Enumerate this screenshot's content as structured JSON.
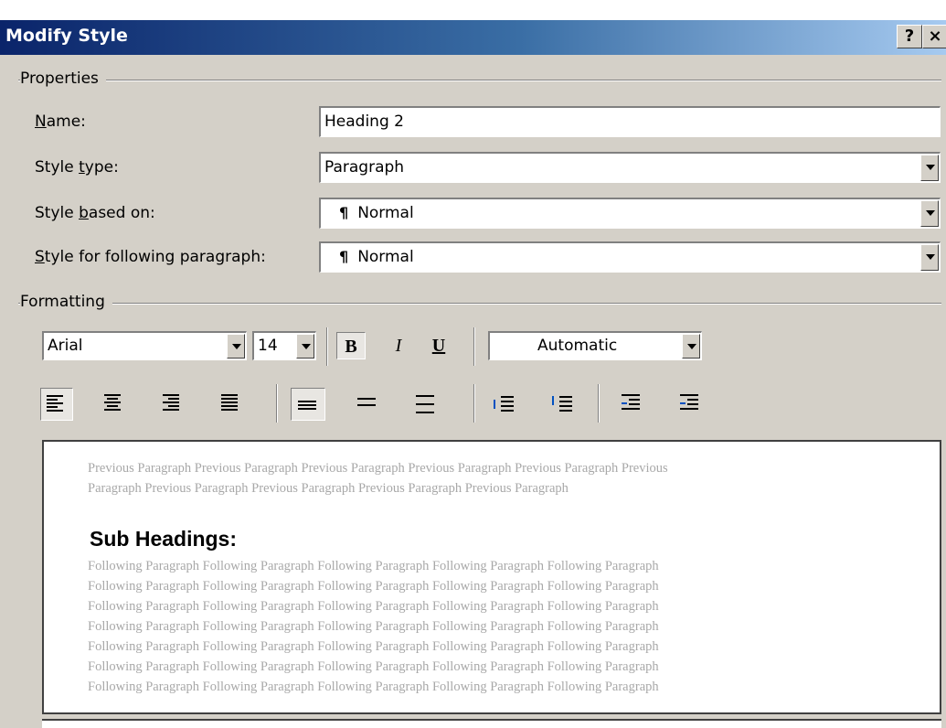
{
  "window": {
    "title": "Modify Style",
    "help_label": "?",
    "close_label": "×"
  },
  "properties": {
    "group_label": "Properties",
    "name": {
      "label_u": "N",
      "label_rest": "ame:",
      "value": "Heading 2"
    },
    "style_type": {
      "label_pre": "Style ",
      "label_u": "t",
      "label_rest": "ype:",
      "value": "Paragraph"
    },
    "based_on": {
      "label_pre": "Style ",
      "label_u": "b",
      "label_rest": "ased on:",
      "value": "Normal",
      "pilcrow": "¶"
    },
    "following": {
      "label_u": "S",
      "label_rest": "tyle for following paragraph:",
      "value": "Normal",
      "pilcrow": "¶"
    }
  },
  "formatting": {
    "group_label": "Formatting",
    "font": "Arial",
    "size": "14",
    "bold": "B",
    "italic": "I",
    "underline": "U",
    "color": "Automatic"
  },
  "preview": {
    "previous_lines": [
      "Previous Paragraph Previous Paragraph Previous Paragraph Previous Paragraph Previous Paragraph Previous",
      "Paragraph Previous Paragraph Previous Paragraph Previous Paragraph Previous Paragraph"
    ],
    "heading": "Sub Headings:",
    "following_lines": [
      "Following Paragraph Following Paragraph Following Paragraph Following Paragraph Following Paragraph",
      "Following Paragraph Following Paragraph Following Paragraph Following Paragraph Following Paragraph",
      "Following Paragraph Following Paragraph Following Paragraph Following Paragraph Following Paragraph",
      "Following Paragraph Following Paragraph Following Paragraph Following Paragraph Following Paragraph",
      "Following Paragraph Following Paragraph Following Paragraph Following Paragraph Following Paragraph",
      "Following Paragraph Following Paragraph Following Paragraph Following Paragraph Following Paragraph",
      "Following Paragraph Following Paragraph Following Paragraph Following Paragraph Following Paragraph"
    ]
  }
}
